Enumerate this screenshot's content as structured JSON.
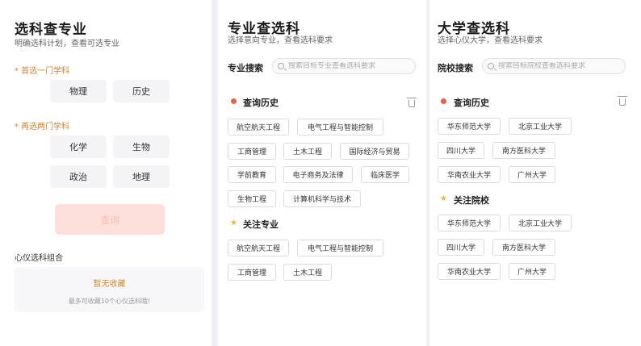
{
  "panel1": {
    "title": "选科查专业",
    "subtitle": "明确选科计划，查看可选专业",
    "first_label": "* 首选一门学科",
    "first_options": [
      "物理",
      "历史"
    ],
    "second_label": "* 再选两门学科",
    "second_options": [
      "化学",
      "生物",
      "政治",
      "地理"
    ],
    "query_button": "查询",
    "combo_label": "心仪选科组合",
    "empty_title": "暂无收藏",
    "empty_hint": "最多可收藏10个心仪选科哦!"
  },
  "panel2": {
    "title": "专业查选科",
    "subtitle": "选择意向专业，查看选科要求",
    "search_label": "专业搜索",
    "search_placeholder": "搜索目标专业查看选科要求",
    "history_title": "查询历史",
    "history_tags": [
      "航空航天工程",
      "电气工程与智能控制",
      "工商管理",
      "土木工程",
      "国际经济与贸易",
      "学前教育",
      "电子商务及法律",
      "临床医学",
      "生物工程",
      "计算机科学与技术"
    ],
    "follow_title": "关注专业",
    "follow_tags": [
      "航空航天工程",
      "电气工程与智能控制",
      "工商管理",
      "土木工程"
    ]
  },
  "panel3": {
    "title": "大学查选科",
    "subtitle": "选择心仪大学，查看选科要求",
    "search_label": "院校搜索",
    "search_placeholder": "搜索目标院校查看选科要求",
    "history_title": "查询历史",
    "history_tags": [
      "华东师范大学",
      "北京工业大学",
      "四川大学",
      "南方医科大学",
      "华南农业大学",
      "广州大学"
    ],
    "follow_title": "关注院校",
    "follow_tags": [
      "华东师范大学",
      "北京工业大学",
      "四川大学",
      "南方医科大学",
      "华南农业大学",
      "广州大学"
    ]
  },
  "colors": {
    "accent": "#c8892e",
    "dot": "#e0624a",
    "star": "#f2b233",
    "query_bg": "#fde0dc"
  },
  "icons": {
    "search": "search-icon",
    "trash": "trash-icon",
    "dot": "history-dot-icon",
    "star": "star-icon"
  }
}
